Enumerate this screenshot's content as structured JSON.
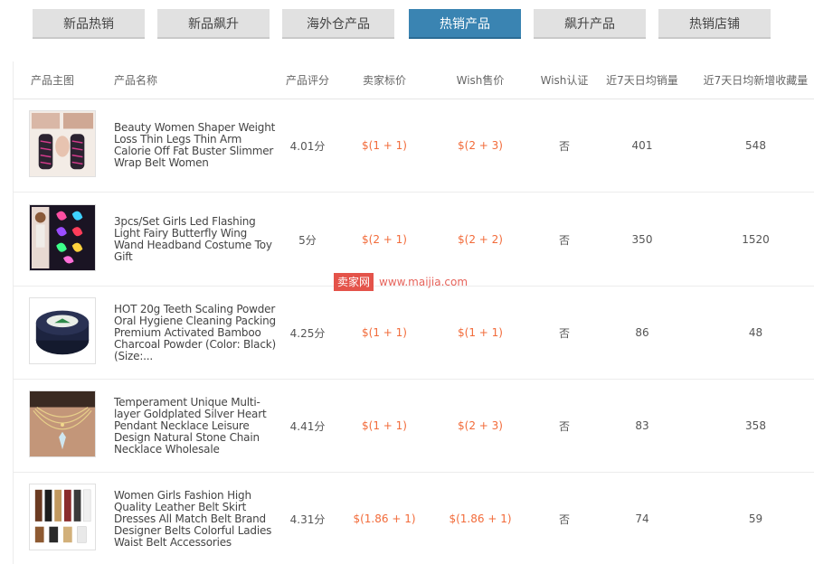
{
  "tabs": [
    {
      "label": "新品热销"
    },
    {
      "label": "新品飙升"
    },
    {
      "label": "海外仓产品"
    },
    {
      "label": "热销产品"
    },
    {
      "label": "飙升产品"
    },
    {
      "label": "热销店铺"
    }
  ],
  "active_tab_index": 3,
  "colors": {
    "tab_active": "#3a84b2",
    "tab_inactive": "#e1e1e1",
    "price": "#f26b3a",
    "watermark": "#e4534a"
  },
  "columns": {
    "image": "产品主图",
    "name": "产品名称",
    "rating": "产品评分",
    "seller_price": "卖家标价",
    "wish_price": "Wish售价",
    "wish_cert": "Wish认证",
    "daily_sales": "近7天日均销量",
    "daily_favorites": "近7天日均新增收藏量"
  },
  "rows": [
    {
      "image_icon": "shapewear-arms-photo",
      "name": "Beauty Women Shaper Weight Loss Thin Legs Thin Arm Calorie Off Fat Buster Slimmer Wrap Belt Women",
      "rating": "4.01分",
      "seller_price": "$(1 + 1)",
      "wish_price": "$(2 + 3)",
      "wish_cert": "否",
      "daily_sales": "401",
      "daily_favorites": "548"
    },
    {
      "image_icon": "butterfly-wings-photo",
      "name": "3pcs/Set Girls Led Flashing Light Fairy Butterfly Wing Wand Headband Costume Toy Gift",
      "rating": "5分",
      "seller_price": "$(2 + 1)",
      "wish_price": "$(2 + 2)",
      "wish_cert": "否",
      "daily_sales": "350",
      "daily_favorites": "1520"
    },
    {
      "image_icon": "teeth-powder-jar-photo",
      "name": "HOT 20g Teeth Scaling Powder Oral Hygiene Cleaning Packing Premium Activated Bamboo Charcoal Powder (Color: Black) (Size:...",
      "rating": "4.25分",
      "seller_price": "$(1 + 1)",
      "wish_price": "$(1 + 1)",
      "wish_cert": "否",
      "daily_sales": "86",
      "daily_favorites": "48"
    },
    {
      "image_icon": "necklace-photo",
      "name": "Temperament Unique Multi-layer Goldplated Silver Heart Pendant Necklace Leisure Design Natural Stone Chain Necklace Wholesale",
      "rating": "4.41分",
      "seller_price": "$(1 + 1)",
      "wish_price": "$(2 + 3)",
      "wish_cert": "否",
      "daily_sales": "83",
      "daily_favorites": "358"
    },
    {
      "image_icon": "leather-belts-photo",
      "name": "Women Girls Fashion High Quality Leather Belt Skirt Dresses All Match Belt Brand Designer Belts Colorful Ladies Waist Belt Accessories",
      "rating": "4.31分",
      "seller_price": "$(1.86 + 1)",
      "wish_price": "$(1.86 + 1)",
      "wish_cert": "否",
      "daily_sales": "74",
      "daily_favorites": "59"
    }
  ],
  "watermark": {
    "label": "卖家网",
    "url": "www.maijia.com"
  }
}
